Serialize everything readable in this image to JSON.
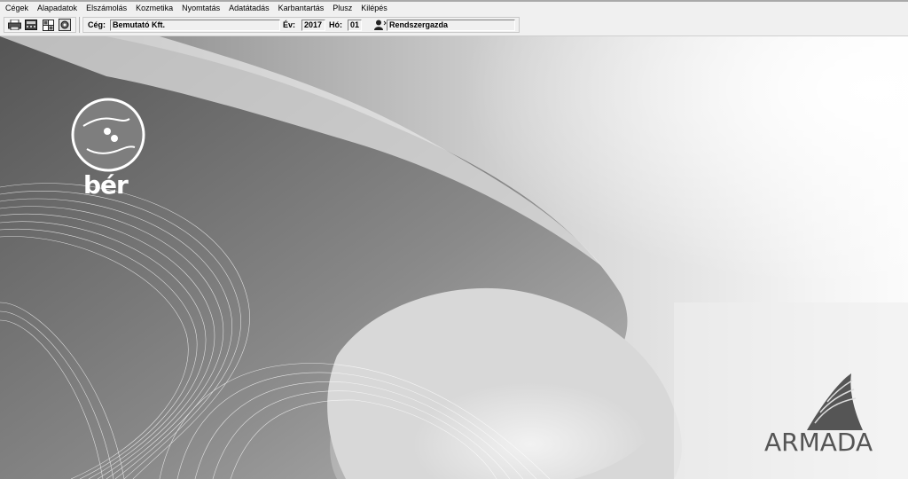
{
  "menu": [
    {
      "label": "Cégek"
    },
    {
      "label": "Alapadatok"
    },
    {
      "label": "Elszámolás"
    },
    {
      "label": "Kozmetika"
    },
    {
      "label": "Nyomtatás"
    },
    {
      "label": "Adatátadás"
    },
    {
      "label": "Karbantartás"
    },
    {
      "label": "Plusz"
    },
    {
      "label": "Kilépés"
    }
  ],
  "toolbar": {
    "buttons": [
      {
        "icon": "printer-icon"
      },
      {
        "icon": "calculator-icon"
      },
      {
        "icon": "grid-icon"
      },
      {
        "icon": "settings-icon"
      }
    ],
    "company_label": "Cég:",
    "company_value": "Bemutató Kft.",
    "year_label": "Év:",
    "year_value": "2017",
    "month_label": "Hó:",
    "month_value": "01",
    "user_value": "Rendszergazda"
  },
  "branding": {
    "product_name": "bér",
    "vendor_name": "ARMADA"
  }
}
